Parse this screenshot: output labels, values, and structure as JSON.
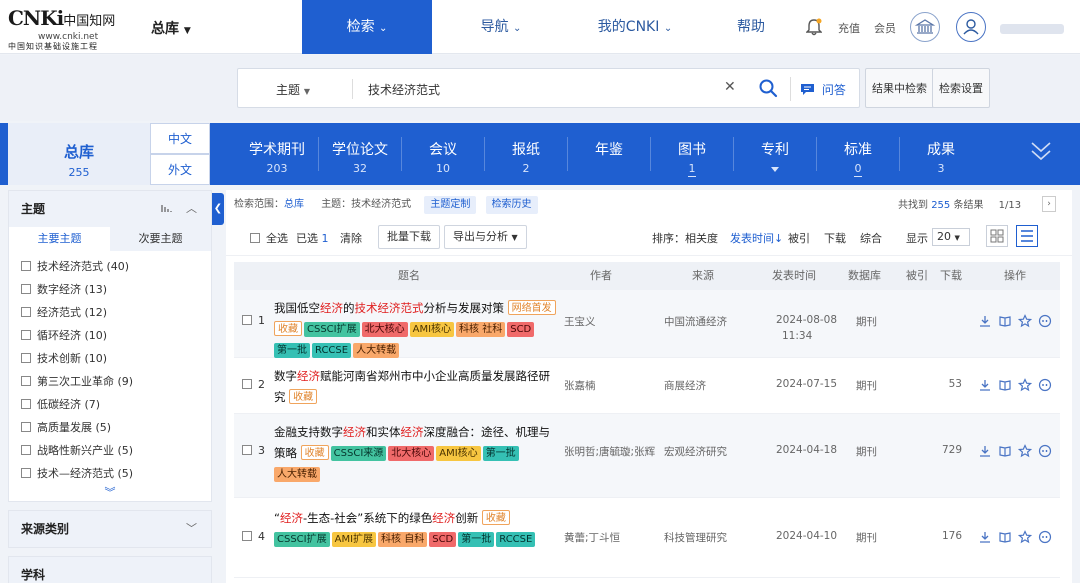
{
  "header": {
    "logo_mark": "CNKi",
    "logo_cn": "中国知网",
    "logo_url": "www.cnki.net",
    "logo_sub": "中国知识基础设施工程",
    "zongku": "总库",
    "nav": [
      {
        "label": "检索"
      },
      {
        "label": "导航"
      },
      {
        "label": "我的CNKI"
      },
      {
        "label": "帮助"
      }
    ],
    "recharge": "充值",
    "member": "会员"
  },
  "search": {
    "type": "主题",
    "query": "技术经济范式",
    "ask": "问答",
    "in_results": "结果中检索",
    "settings": "检索设置"
  },
  "db": {
    "main": {
      "label": "总库",
      "count": "255"
    },
    "lang_cn": "中文",
    "lang_foreign": "外文",
    "tabs": [
      {
        "label": "学术期刊",
        "count": "203"
      },
      {
        "label": "学位论文",
        "count": "32"
      },
      {
        "label": "会议",
        "count": "10"
      },
      {
        "label": "报纸",
        "count": "2"
      },
      {
        "label": "年鉴",
        "count": ""
      },
      {
        "label": "图书",
        "count": "1"
      },
      {
        "label": "专利",
        "count": ""
      },
      {
        "label": "标准",
        "count": "0"
      },
      {
        "label": "成果",
        "count": "3"
      }
    ]
  },
  "sidebar": {
    "topic_title": "主题",
    "subtab_main": "主要主题",
    "subtab_minor": "次要主题",
    "facets": [
      "技术经济范式 (40)",
      "数字经济 (13)",
      "经济范式 (12)",
      "循环经济 (10)",
      "技术创新 (10)",
      "第三次工业革命 (9)",
      "低碳经济 (7)",
      "高质量发展 (5)",
      "战略性新兴产业 (5)",
      "技术—经济范式 (5)"
    ],
    "source_title": "来源类别",
    "subject_title": "学科"
  },
  "results": {
    "scope_label": "检索范围：",
    "scope_value": "总库",
    "scope_topic": "主题：技术经济范式",
    "chip_customize": "主题定制",
    "chip_history": "检索历史",
    "found_prefix": "共找到",
    "found_count": "255",
    "found_suffix": "条结果",
    "page": "1/13",
    "toolbar": {
      "select_all": "全选",
      "selected": "已选",
      "selected_count": "1",
      "clear": "清除",
      "batch_download": "批量下载",
      "export": "导出与分析",
      "sort_label": "排序：",
      "sort_relevance": "相关度",
      "sort_date": "发表时间",
      "sort_cited": "被引",
      "sort_download": "下载",
      "sort_overall": "综合",
      "show_label": "显示",
      "show_value": "20"
    },
    "columns": [
      "题名",
      "作者",
      "来源",
      "发表时间",
      "数据库",
      "被引",
      "下载",
      "操作"
    ],
    "rows": [
      {
        "num": "1",
        "title_parts": [
          {
            "t": "我国低空",
            "hl": false
          },
          {
            "t": "经济",
            "hl": true
          },
          {
            "t": "的",
            "hl": false
          },
          {
            "t": "技术经济范式",
            "hl": true
          },
          {
            "t": "分析与发展对策",
            "hl": false
          }
        ],
        "tags": [
          {
            "t": "网络首发",
            "c": "plain"
          },
          {
            "t": "收藏",
            "c": "plain"
          },
          {
            "t": "CSSCI扩展",
            "c": "green"
          },
          {
            "t": "北大核心",
            "c": "red"
          },
          {
            "t": "AMI核心",
            "c": "yellow"
          },
          {
            "t": "科核 社科",
            "c": "orange"
          },
          {
            "t": "SCD",
            "c": "red"
          },
          {
            "t": "第一批",
            "c": "teal"
          },
          {
            "t": "RCCSE",
            "c": "teal"
          },
          {
            "t": "人大转载",
            "c": "orange"
          }
        ],
        "author": "王宝义",
        "source": "中国流通经济",
        "date": "2024-08-08",
        "time": "11:34",
        "db": "期刊",
        "cited": "",
        "downloads": ""
      },
      {
        "num": "2",
        "title_parts": [
          {
            "t": "数字",
            "hl": false
          },
          {
            "t": "经济",
            "hl": true
          },
          {
            "t": "赋能河南省郑州市中小企业高质量发展路径研究",
            "hl": false
          }
        ],
        "tags": [
          {
            "t": "收藏",
            "c": "plain"
          }
        ],
        "author": "张嘉楠",
        "source": "商展经济",
        "date": "2024-07-15",
        "time": "",
        "db": "期刊",
        "cited": "",
        "downloads": "53"
      },
      {
        "num": "3",
        "title_parts": [
          {
            "t": "金融支持数字",
            "hl": false
          },
          {
            "t": "经济",
            "hl": true
          },
          {
            "t": "和实体",
            "hl": false
          },
          {
            "t": "经济",
            "hl": true
          },
          {
            "t": "深度融合：途径、机理与策略",
            "hl": false
          }
        ],
        "tags": [
          {
            "t": "收藏",
            "c": "plain"
          },
          {
            "t": "CSSCI来源",
            "c": "green"
          },
          {
            "t": "北大核心",
            "c": "red"
          },
          {
            "t": "AMI核心",
            "c": "yellow"
          },
          {
            "t": "第一批",
            "c": "teal"
          },
          {
            "t": "人大转载",
            "c": "orange"
          }
        ],
        "author": "张明哲;唐毓璇;张辉",
        "source": "宏观经济研究",
        "date": "2024-04-18",
        "time": "",
        "db": "期刊",
        "cited": "",
        "downloads": "729"
      },
      {
        "num": "4",
        "title_parts": [
          {
            "t": "“",
            "hl": false
          },
          {
            "t": "经济",
            "hl": true
          },
          {
            "t": "-生态-社会”系统下的绿色",
            "hl": false
          },
          {
            "t": "经济",
            "hl": true
          },
          {
            "t": "创新",
            "hl": false
          }
        ],
        "tags": [
          {
            "t": "收藏",
            "c": "plain"
          },
          {
            "t": "CSSCI扩展",
            "c": "green"
          },
          {
            "t": "AMI扩展",
            "c": "yellow"
          },
          {
            "t": "科核 自科",
            "c": "orange"
          },
          {
            "t": "SCD",
            "c": "red"
          },
          {
            "t": "第一批",
            "c": "teal"
          },
          {
            "t": "RCCSE",
            "c": "teal"
          }
        ],
        "author": "黄蕾;丁斗恒",
        "source": "科技管理研究",
        "date": "2024-04-10",
        "time": "",
        "db": "期刊",
        "cited": "",
        "downloads": "176"
      }
    ]
  }
}
